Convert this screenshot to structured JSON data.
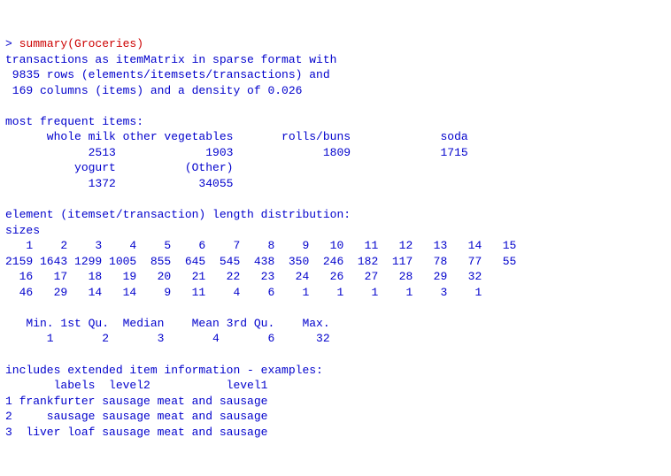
{
  "prompt": {
    "gt": "> ",
    "command": "summary(Groceries)"
  },
  "summary_header": {
    "line1": "transactions as itemMatrix in sparse format with",
    "line2": " 9835 rows (elements/itemsets/transactions) and",
    "line3": " 169 columns (items) and a density of 0.026"
  },
  "freq": {
    "heading": "most frequent items:",
    "row_names": "      whole milk other vegetables       rolls/buns             soda",
    "row_values": "            2513             1903             1809             1715",
    "row_names2": "          yogurt          (Other)",
    "row_values2": "            1372            34055"
  },
  "lengthdist": {
    "heading": "element (itemset/transaction) length distribution:",
    "sizes_label": "sizes",
    "sizes_row1": "   1    2    3    4    5    6    7    8    9   10   11   12   13   14   15",
    "counts_row1": "2159 1643 1299 1005  855  645  545  438  350  246  182  117   78   77   55",
    "sizes_row2": "  16   17   18   19   20   21   22   23   24   26   27   28   29   32",
    "counts_row2": "  46   29   14   14    9   11    4    6    1    1    1    1    3    1"
  },
  "fivenum": {
    "header": "   Min. 1st Qu.  Median    Mean 3rd Qu.    Max.",
    "values": "      1       2       3       4       6      32"
  },
  "extinfo": {
    "heading": "includes extended item information - examples:",
    "colhead": "       labels  level2           level1",
    "row1": "1 frankfurter sausage meat and sausage",
    "row2": "2     sausage sausage meat and sausage",
    "row3": "3  liver loaf sausage meat and sausage"
  }
}
